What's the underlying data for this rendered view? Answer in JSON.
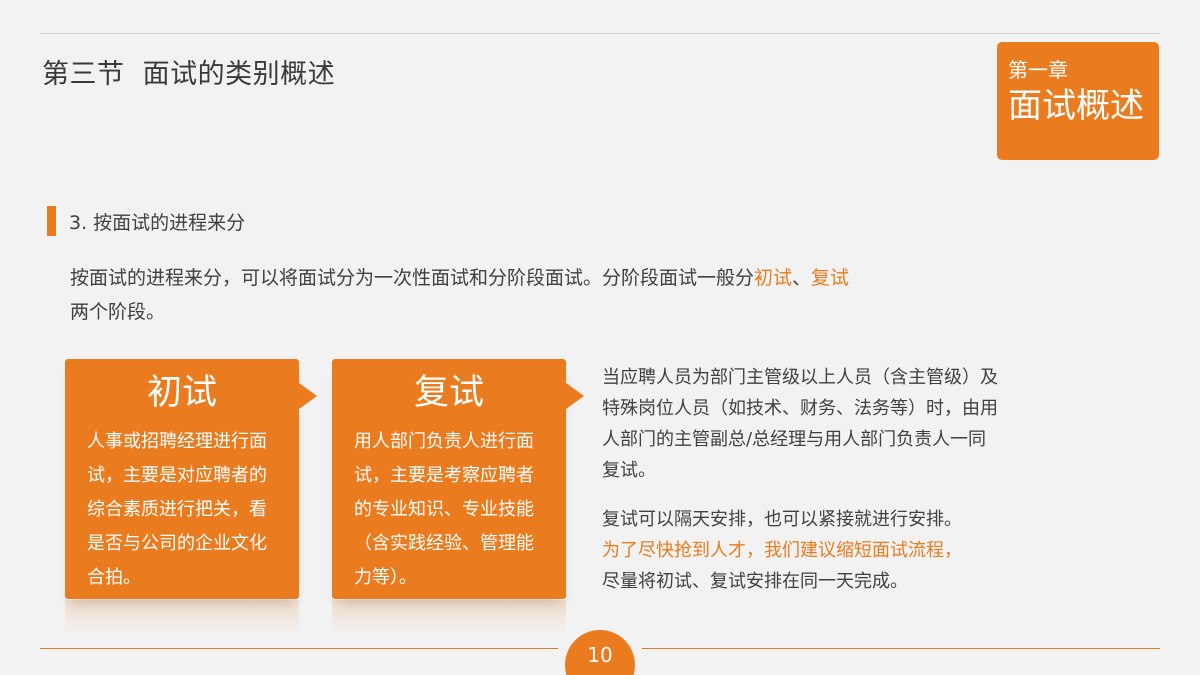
{
  "header": {
    "section_title": "第三节  面试的类别概述",
    "chapter_label": "第一章",
    "chapter_name": "面试概述"
  },
  "subheading": "3. 按面试的进程来分",
  "intro": {
    "text_before": "按面试的进程来分，可以将面试分为一次性面试和分阶段面试。分阶段面试一般分",
    "highlight_1": "初试",
    "separator": "、",
    "highlight_2": "复试",
    "text_after": "两个阶段。"
  },
  "cards": [
    {
      "title": "初试",
      "body": "人事或招聘经理进行面试，主要是对应聘者的综合素质进行把关，看是否与公司的企业文化合拍。"
    },
    {
      "title": "复试",
      "body": "用人部门负责人进行面试，主要是考察应聘者的专业知识、专业技能（含实践经验、管理能力等）。"
    }
  ],
  "side": {
    "paragraph_1": "当应聘人员为部门主管级以上人员（含主管级）及特殊岗位人员（如技术、财务、法务等）时，由用人部门的主管副总/总经理与用人部门负责人一同复试。",
    "paragraph_2_text": "复试可以隔天安排，也可以紧接就进行安排。",
    "paragraph_2_highlight": "为了尽快抢到人才，我们建议缩短面试流程，",
    "paragraph_2_end": "尽量将初试、复试安排在同一天完成。"
  },
  "footer": {
    "page_number": "10"
  },
  "colors": {
    "accent": "#ea7b1e",
    "background": "#f2f2f2",
    "text": "#404040"
  }
}
